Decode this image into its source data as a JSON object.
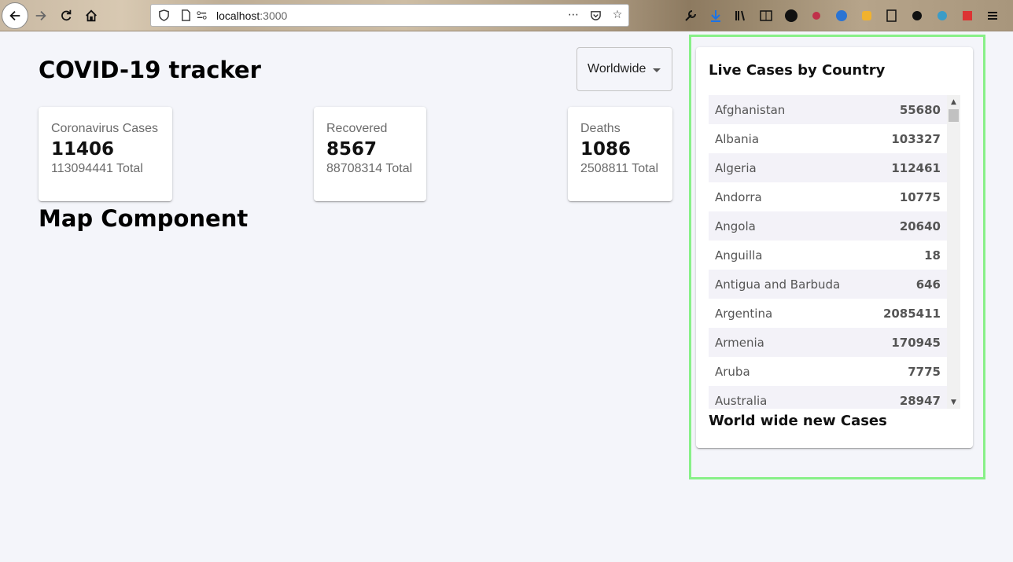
{
  "browser": {
    "url_host": "localhost",
    "url_port": ":3000"
  },
  "header": {
    "title": "COVID-19 tracker",
    "country_select": "Worldwide"
  },
  "stats": [
    {
      "title": "Coronavirus Cases",
      "cases": "11406",
      "total": "113094441 Total"
    },
    {
      "title": "Recovered",
      "cases": "8567",
      "total": "88708314 Total"
    },
    {
      "title": "Deaths",
      "cases": "1086",
      "total": "2508811 Total"
    }
  ],
  "map": {
    "heading": "Map Component"
  },
  "sidebar": {
    "title": "Live Cases by Country",
    "subtitle": "World wide new Cases",
    "countries": [
      {
        "name": "Afghanistan",
        "cases": "55680"
      },
      {
        "name": "Albania",
        "cases": "103327"
      },
      {
        "name": "Algeria",
        "cases": "112461"
      },
      {
        "name": "Andorra",
        "cases": "10775"
      },
      {
        "name": "Angola",
        "cases": "20640"
      },
      {
        "name": "Anguilla",
        "cases": "18"
      },
      {
        "name": "Antigua and Barbuda",
        "cases": "646"
      },
      {
        "name": "Argentina",
        "cases": "2085411"
      },
      {
        "name": "Armenia",
        "cases": "170945"
      },
      {
        "name": "Aruba",
        "cases": "7775"
      },
      {
        "name": "Australia",
        "cases": "28947"
      }
    ]
  },
  "colors": {
    "page_bg": "#f4f5fa",
    "highlight": "#88f088",
    "row_alt": "#f3f2f8"
  },
  "icons": [
    "back-arrow-icon",
    "forward-arrow-icon",
    "reload-icon",
    "home-icon",
    "shield-icon",
    "page-icon",
    "permissions-icon",
    "more-icon",
    "pocket-icon",
    "star-icon",
    "wrench-icon",
    "download-icon",
    "library-icon",
    "reader-icon",
    "extension-icons",
    "menu-icon"
  ]
}
